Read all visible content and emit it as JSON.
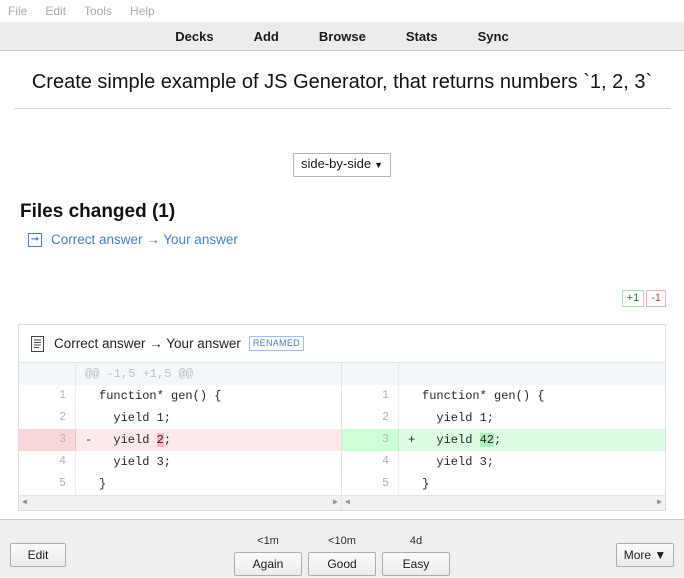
{
  "menubar": {
    "items": [
      {
        "label": "File"
      },
      {
        "label": "Edit"
      },
      {
        "label": "Tools"
      },
      {
        "label": "Help"
      }
    ]
  },
  "navbar": {
    "items": [
      {
        "label": "Decks"
      },
      {
        "label": "Add"
      },
      {
        "label": "Browse"
      },
      {
        "label": "Stats"
      },
      {
        "label": "Sync"
      }
    ]
  },
  "card": {
    "question": "Create simple example of JS Generator, that returns numbers `1, 2, 3`",
    "view_mode": {
      "value": "side-by-side",
      "caret": "▼"
    },
    "files_changed_title": "Files changed (1)",
    "summary": {
      "icon": "rename-arrow-icon",
      "link_text": "Correct answer → Your answer"
    },
    "diffstat": {
      "additions": "+1",
      "deletions": "-1"
    },
    "file": {
      "icon": "file-icon",
      "name": "Correct answer → Your answer",
      "badge": "RENAMED"
    },
    "diff": {
      "hunk_header": "@@ -1,5 +1,5 @@",
      "left": [
        {
          "type": "hunk",
          "num": "",
          "sign": "",
          "pre": "",
          "hl": "",
          "post": ""
        },
        {
          "type": "ctx",
          "num": "1",
          "sign": " ",
          "pre": "function* gen() {",
          "hl": "",
          "post": ""
        },
        {
          "type": "ctx",
          "num": "2",
          "sign": " ",
          "pre": "  yield 1;",
          "hl": "",
          "post": ""
        },
        {
          "type": "del",
          "num": "3",
          "sign": "-",
          "pre": "  yield ",
          "hl": "2",
          "post": ";"
        },
        {
          "type": "ctx",
          "num": "4",
          "sign": " ",
          "pre": "  yield 3;",
          "hl": "",
          "post": ""
        },
        {
          "type": "ctx",
          "num": "5",
          "sign": " ",
          "pre": "}",
          "hl": "",
          "post": ""
        }
      ],
      "right": [
        {
          "type": "hunk",
          "num": "",
          "sign": "",
          "pre": "",
          "hl": "",
          "post": ""
        },
        {
          "type": "ctx",
          "num": "1",
          "sign": " ",
          "pre": "function* gen() {",
          "hl": "",
          "post": ""
        },
        {
          "type": "ctx",
          "num": "2",
          "sign": " ",
          "pre": "  yield 1;",
          "hl": "",
          "post": ""
        },
        {
          "type": "add",
          "num": "3",
          "sign": "+",
          "pre": "  yield ",
          "hl": "42",
          "post": ";"
        },
        {
          "type": "ctx",
          "num": "4",
          "sign": " ",
          "pre": "  yield 3;",
          "hl": "",
          "post": ""
        },
        {
          "type": "ctx",
          "num": "5",
          "sign": " ",
          "pre": "}",
          "hl": "",
          "post": ""
        }
      ]
    }
  },
  "bottombar": {
    "edit_label": "Edit",
    "more_label": "More ▼",
    "answers": [
      {
        "interval": "<1m",
        "label": "Again"
      },
      {
        "interval": "<10m",
        "label": "Good"
      },
      {
        "interval": "4d",
        "label": "Easy"
      }
    ]
  },
  "colors": {
    "accent_link": "#4a7ebb",
    "add_bg": "#ddfbe3",
    "add_hl": "#acf2bd",
    "del_bg": "#fbe9eb",
    "del_hl": "#fdb8c0",
    "nav_bg": "#ececec",
    "bottom_bg": "#efefef"
  }
}
